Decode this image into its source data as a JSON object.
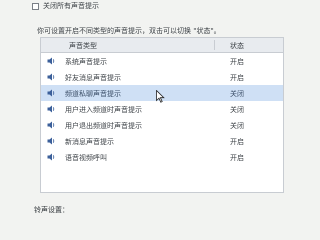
{
  "mute_all": {
    "label": "关闭所有声音提示",
    "checked": false
  },
  "description": "你可设置开启不同类型的声音提示，双击可以切换 \"状态\"。",
  "table": {
    "headers": {
      "type": "声音类型",
      "status": "状态"
    },
    "rows": [
      {
        "name": "系统声音提示",
        "status": "开启"
      },
      {
        "name": "好友消息声音提示",
        "status": "开启"
      },
      {
        "name": "频道私聊声音提示",
        "status": "关闭",
        "selected": true
      },
      {
        "name": "用户进入频道时声音提示",
        "status": "关闭"
      },
      {
        "name": "用户退出频道时声音提示",
        "status": "关闭"
      },
      {
        "name": "新消息声音提示",
        "status": "开启"
      },
      {
        "name": "语音视频呼叫",
        "status": "开启"
      }
    ]
  },
  "footer_label": "铃声设置：",
  "icons": {
    "row_icon": "speaker-icon",
    "cursor": "mouse-pointer-icon"
  }
}
